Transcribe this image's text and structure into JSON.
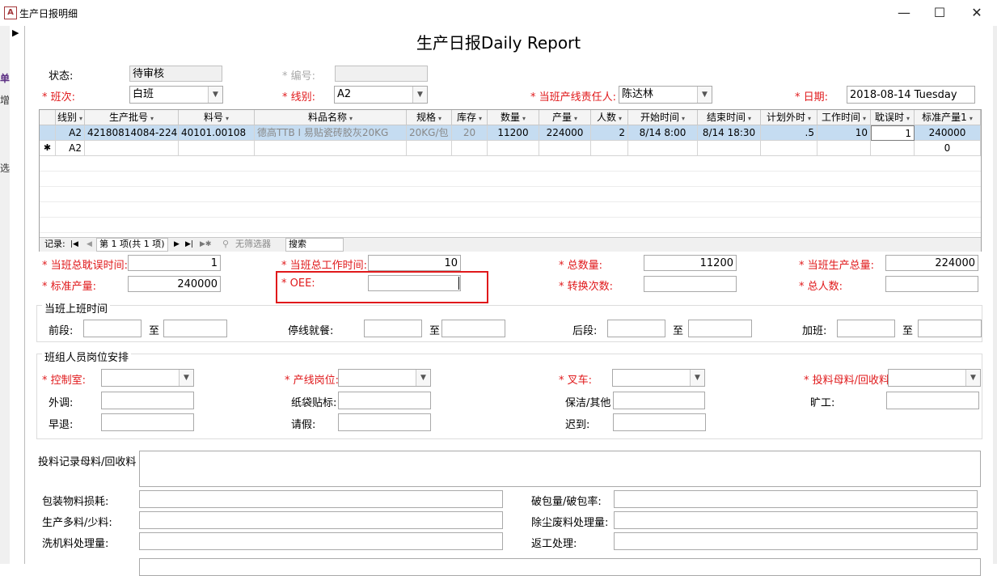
{
  "window": {
    "title": "生产日报明细",
    "app_icon": "A",
    "minimize": "—",
    "maximize": "☐",
    "close": "✕"
  },
  "side_fragments": [
    "单",
    "增",
    "选"
  ],
  "record_selector": "▶",
  "form": {
    "title": "生产日报Daily Report",
    "status_label": "状态:",
    "status_value": "待审核",
    "code_label": "* 编号:",
    "code_value": "",
    "shift_label": "* 班次:",
    "shift_value": "白班",
    "line_label": "* 线别:",
    "line_value": "A2",
    "leader_label": "* 当班产线责任人:",
    "leader_value": "陈达林",
    "date_label": "* 日期:",
    "date_value": "2018-08-14 Tuesday"
  },
  "grid": {
    "columns": [
      "线别",
      "生产批号",
      "料号",
      "料品名称",
      "规格",
      "库存",
      "数量",
      "产量",
      "人数",
      "开始时间",
      "结束时间",
      "计划外时",
      "工作时间",
      "耽误时",
      "标准产量1"
    ],
    "rows": [
      [
        "A2",
        "42180814084-224",
        "40101.00108",
        "德高TTB I 易贴瓷砖胶灰20KG",
        "20KG/包",
        "20",
        "11200",
        "224000",
        "2",
        "8/14 8:00",
        "8/14 18:30",
        ".5",
        "10",
        "1",
        "240000"
      ]
    ],
    "new_row_marker": "✱",
    "new_row_line": "A2",
    "new_row_std": "0",
    "nav": {
      "label": "记录:",
      "first": "|◀",
      "prev": "◀",
      "position": "第 1 项(共 1 项)",
      "next": "▶",
      "last": "▶|",
      "new": "▶✱",
      "filter": "无筛选器",
      "search": "搜索"
    }
  },
  "totals": {
    "delay_label": "* 当班总耽误时间:",
    "delay_value": "1",
    "work_label": "* 当班总工作时间:",
    "work_value": "10",
    "qty_label": "* 总数量:",
    "qty_value": "11200",
    "output_label": "* 当班生产总量:",
    "output_value": "224000",
    "std_label": "* 标准产量:",
    "std_value": "240000",
    "oee_label": "* OEE:",
    "oee_value": "",
    "changeover_label": "* 转换次数:",
    "changeover_value": "",
    "people_label": "* 总人数:",
    "people_value": ""
  },
  "shift_time": {
    "group_title": "当班上班时间",
    "front_label": "前段:",
    "stop_label": "停线就餐:",
    "back_label": "后段:",
    "ot_label": "加班:",
    "to": "至"
  },
  "staff": {
    "group_title": "班组人员岗位安排",
    "control_label": "* 控制室:",
    "prodpos_label": "* 产线岗位:",
    "forklift_label": "* 叉车:",
    "feed_label": "* 投料母料/回收料",
    "transfer_label": "外调:",
    "bag_label": "纸袋贴标:",
    "clean_label": "保洁/其他",
    "absent_label": "旷工:",
    "early_label": "早退:",
    "leave_label": "请假:",
    "late_label": "迟到:"
  },
  "materials": {
    "feedrec_label": "投料记录母料/回收料",
    "pack_label": "包装物料损耗:",
    "broken_label": "破包量/破包率:",
    "extra_label": "生产多料/少料:",
    "dust_label": "除尘废料处理量:",
    "wash_label": "洗机料处理量:",
    "rework_label": "返工处理:"
  },
  "colors": {
    "required": "#e0191b",
    "selected_row": "#c5dcf1",
    "highlight_box": "#e0191b"
  }
}
